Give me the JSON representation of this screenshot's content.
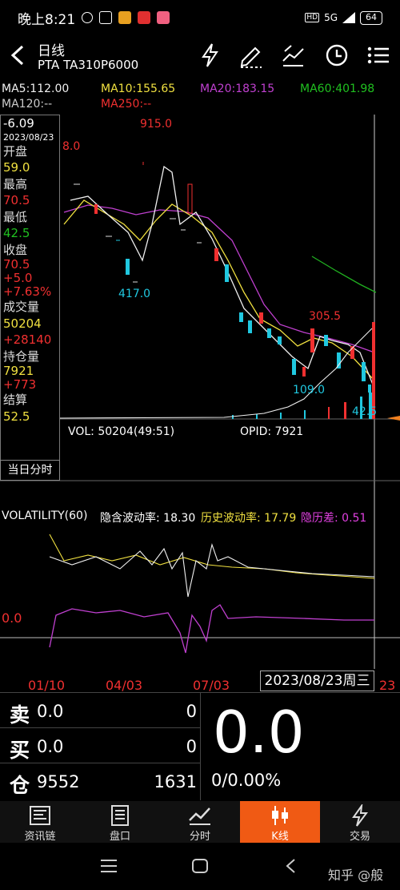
{
  "status_bar": {
    "time": "晚上8:21",
    "network": "5G",
    "battery": "64"
  },
  "header": {
    "title": "日线",
    "subtitle": "PTA TA310P6000",
    "icons": [
      "lightning-icon",
      "pen-icon",
      "trend-icon",
      "clock-icon",
      "menu-list-icon"
    ]
  },
  "ma_legend": {
    "ma5": "MA5:112.00",
    "ma10": "MA10:155.65",
    "ma20": "MA20:183.15",
    "ma60": "MA60:401.98",
    "ma120": "MA120:--",
    "ma250": "MA250:--"
  },
  "info_panel": {
    "change": "-6.09",
    "date": "2023/08/23",
    "open_label": "开盘",
    "open": "59.0",
    "high_label": "最高",
    "high": "70.5",
    "low_label": "最低",
    "low": "42.5",
    "close_label": "收盘",
    "close": "70.5",
    "close_chg": "+5.0",
    "close_pct": "+7.63%",
    "vol_label": "成交量",
    "vol": "50204",
    "vol_chg": "+28140",
    "oi_label": "持仓量",
    "oi": "7921",
    "oi_chg": "+773",
    "settle_label": "结算",
    "settle": "52.5",
    "intraday_button": "当日分时"
  },
  "chart_labels": {
    "peak_high": "915.0",
    "left_edge_value": "8.0",
    "trough_417": "417.0",
    "peak_305": "305.5",
    "trough_109": "109.0",
    "last_low": "42.5"
  },
  "volume_panel": {
    "vol": "VOL: 50204(49:51)",
    "opid": "OPID: 7921"
  },
  "volatility_panel": {
    "title": "VOLATILITY(60)",
    "implied": "隐含波动率: 18.30",
    "historical": "历史波动率: 17.79",
    "diff": "隐历差: 0.51",
    "zero_label": "0.0"
  },
  "x_axis": [
    "01/10",
    "04/03",
    "07/03",
    "23"
  ],
  "date_tag": "2023/08/23周三",
  "quote": {
    "sell_label": "卖",
    "sell_price": "0.0",
    "sell_qty": "0",
    "buy_label": "买",
    "buy_price": "0.0",
    "buy_qty": "0",
    "oi_label": "仓",
    "oi_value": "9552",
    "oi_change": "1631",
    "last_price": "0.0",
    "change": "0/0.00%"
  },
  "tabs": [
    {
      "label": "资讯链"
    },
    {
      "label": "盘口"
    },
    {
      "label": "分时"
    },
    {
      "label": "K线"
    },
    {
      "label": "交易"
    }
  ],
  "watermark": "知乎 @般",
  "colors": {
    "up": "#f03030",
    "down": "#20c8e0",
    "ma5": "#f0f0f0",
    "ma10": "#f0e040",
    "ma20": "#c040d0",
    "ma60": "#20b020",
    "accent": "#f05a14"
  },
  "chart_data": {
    "type": "candlestick",
    "ma_lines": [
      "MA5",
      "MA10",
      "MA20",
      "MA60"
    ],
    "price_labels": [
      915.0,
      417.0,
      305.5,
      109.0,
      42.5
    ],
    "x_ticks": [
      "01/10",
      "04/03",
      "07/03",
      "23"
    ]
  }
}
